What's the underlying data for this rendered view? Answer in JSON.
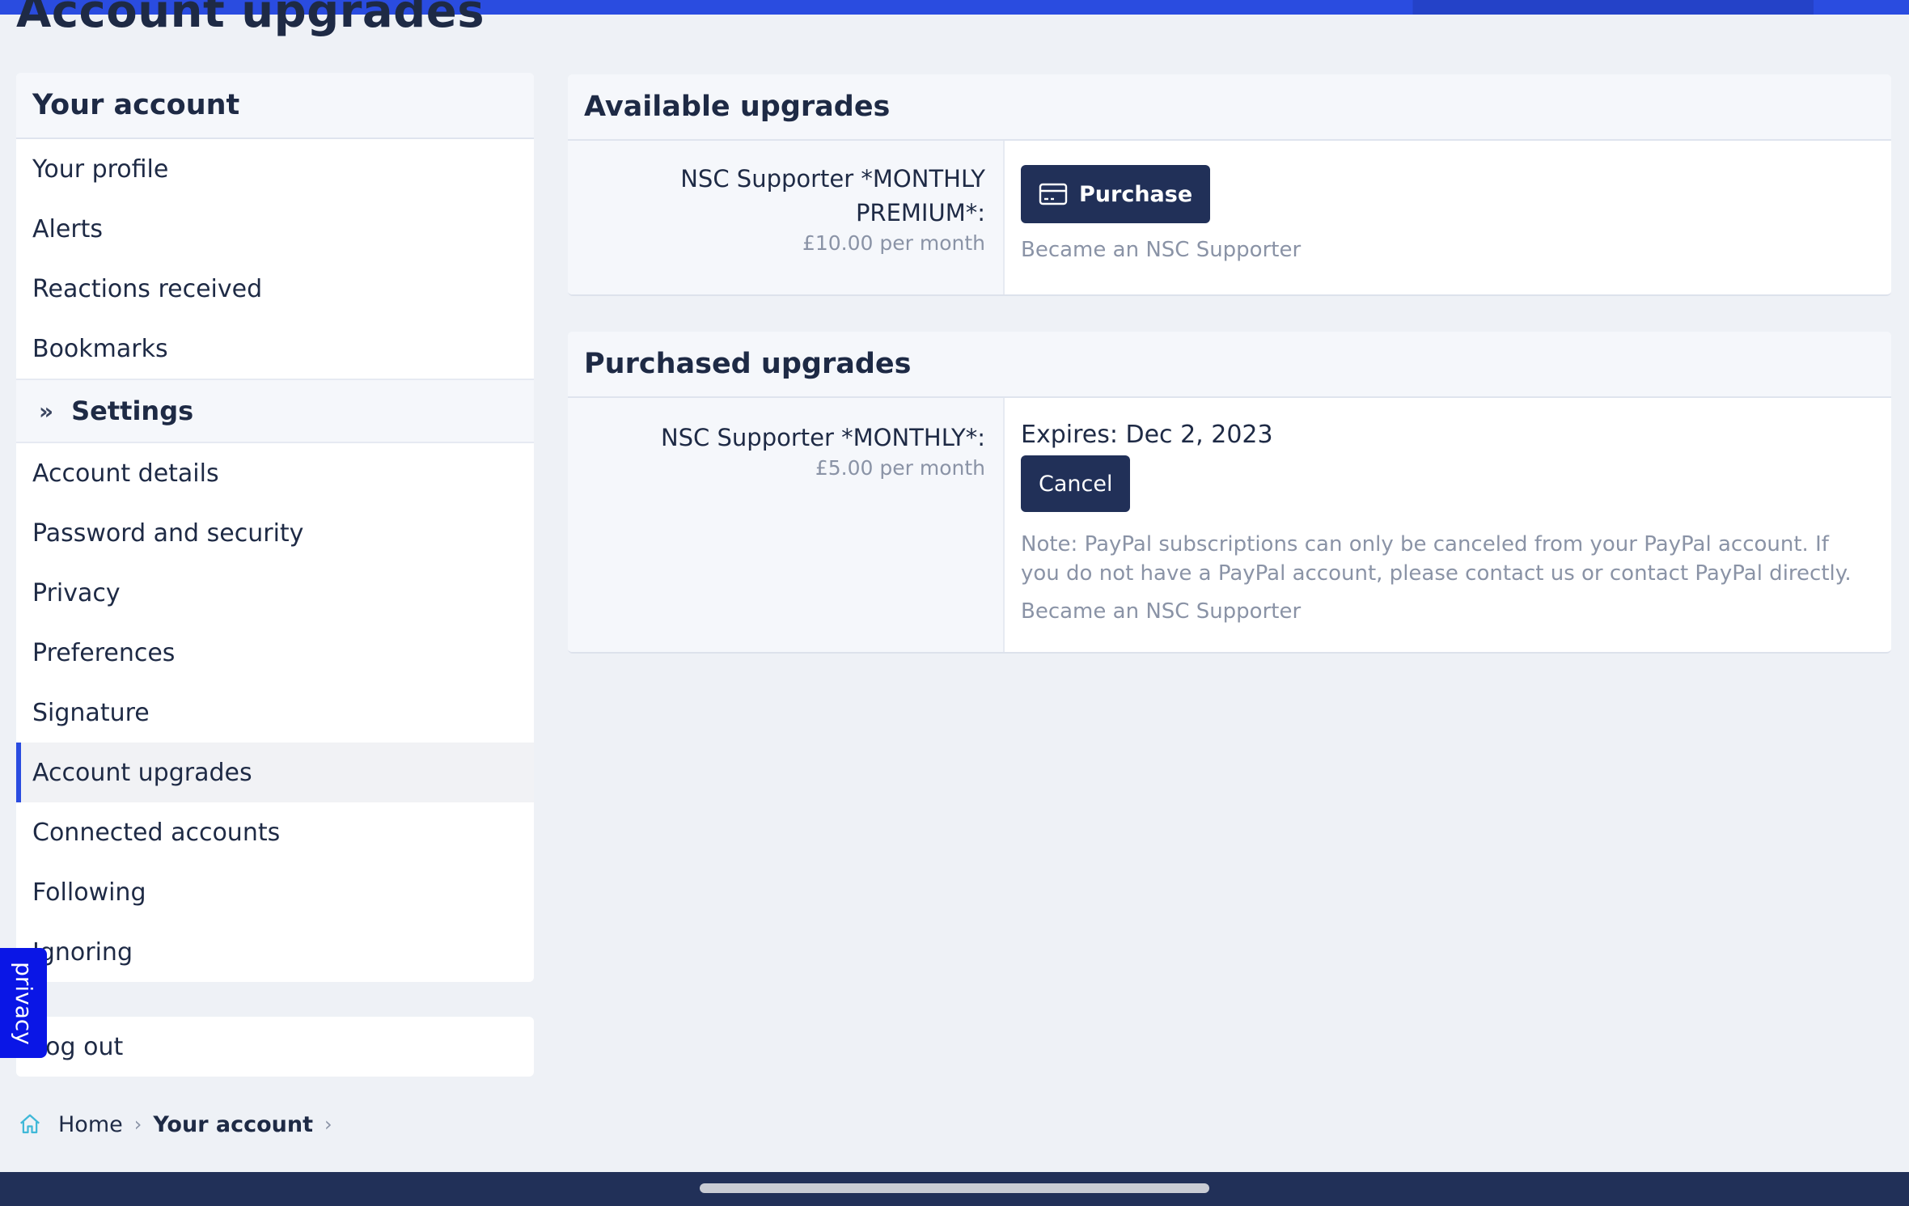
{
  "page": {
    "title": "Account upgrades"
  },
  "sidebar": {
    "header": "Your account",
    "items_top": [
      {
        "label": "Your profile"
      },
      {
        "label": "Alerts"
      },
      {
        "label": "Reactions received"
      },
      {
        "label": "Bookmarks"
      }
    ],
    "section_label": "Settings",
    "items_settings": [
      {
        "label": "Account details"
      },
      {
        "label": "Password and security"
      },
      {
        "label": "Privacy"
      },
      {
        "label": "Preferences"
      },
      {
        "label": "Signature"
      },
      {
        "label": "Account upgrades",
        "active": true
      },
      {
        "label": "Connected accounts"
      },
      {
        "label": "Following"
      },
      {
        "label": "Ignoring"
      }
    ],
    "logout_label": "Log out"
  },
  "privacy_tab": {
    "label": "privacy"
  },
  "breadcrumb": {
    "home": "Home",
    "current": "Your account"
  },
  "available": {
    "header": "Available upgrades",
    "item": {
      "title": "NSC Supporter *MONTHLY PREMIUM*:",
      "price": "£10.00 per month",
      "button": "Purchase",
      "description": "Became an NSC Supporter"
    }
  },
  "purchased": {
    "header": "Purchased upgrades",
    "item": {
      "title": "NSC Supporter *MONTHLY*:",
      "price": "£5.00 per month",
      "expires": "Expires: Dec 2, 2023",
      "button": "Cancel",
      "note": "Note: PayPal subscriptions can only be canceled from your PayPal account. If you do not have a PayPal account, please contact us or contact PayPal directly.",
      "description": "Became an NSC Supporter"
    }
  },
  "colors": {
    "accent": "#2a4ce0",
    "button": "#213058",
    "privacy_tab": "#0a16e6"
  }
}
